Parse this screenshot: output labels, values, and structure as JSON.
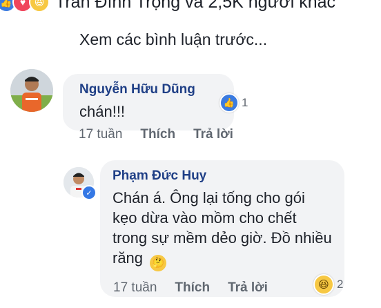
{
  "post": {
    "reactions_text": "Trần Đình Trọng và 2,5K người khác",
    "view_previous": "Xem các bình luận trước..."
  },
  "comments": [
    {
      "author": "Nguyễn Hữu Dũng",
      "text": "chán!!!",
      "reaction_count": "1",
      "reaction_icon": "like-icon",
      "time": "17 tuần",
      "like_label": "Thích",
      "reply_label": "Trả lời"
    },
    {
      "author": "Phạm Đức Huy",
      "text": "Chán á. Ông lại tống cho gói kẹo dừa vào mồm cho chết trong sự mềm dẻo giờ. Đồ nhiều răng",
      "reaction_count": "2",
      "reaction_icon": "haha-icon",
      "time": "17 tuần",
      "like_label": "Thích",
      "reply_label": "Trả lời",
      "verified": true
    }
  ],
  "colors": {
    "author": "#1f3f86",
    "bubble": "#f2f3f5",
    "like_blue": "#3b7be0",
    "love_red": "#f0445b",
    "haha_yellow": "#f7c843",
    "meta_gray": "#606770"
  }
}
